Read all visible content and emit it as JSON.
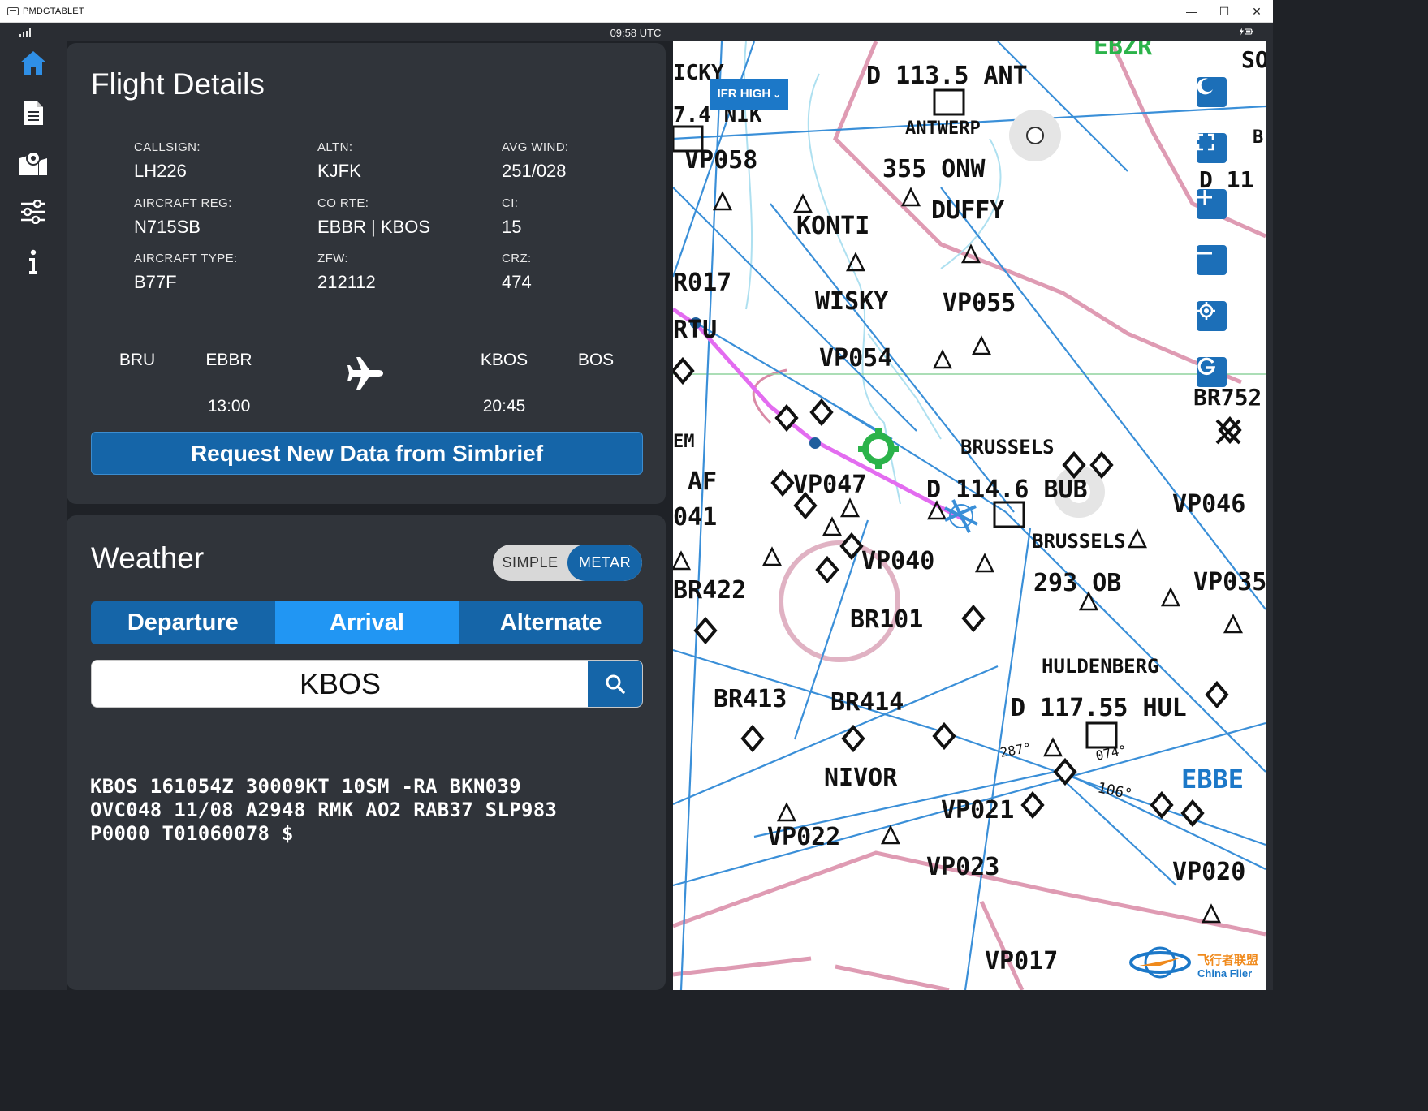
{
  "window": {
    "title": "PMDGTABLET",
    "minimize": "—",
    "maximize": "☐",
    "close": "✕"
  },
  "status": {
    "time": "09:58 UTC"
  },
  "sidebar": [
    {
      "name": "home-icon"
    },
    {
      "name": "document-icon"
    },
    {
      "name": "map-icon"
    },
    {
      "name": "settings-sliders-icon"
    },
    {
      "name": "info-icon"
    }
  ],
  "flight_details": {
    "title": "Flight Details",
    "fields": {
      "callsign": {
        "label": "CALLSIGN:",
        "value": "LH226"
      },
      "altn": {
        "label": "ALTN:",
        "value": "KJFK"
      },
      "avg_wind": {
        "label": "AVG WIND:",
        "value": "251/028"
      },
      "aircraft_reg": {
        "label": "AIRCRAFT REG:",
        "value": "N715SB"
      },
      "co_rte": {
        "label": "CO RTE:",
        "value": "EBBR | KBOS"
      },
      "ci": {
        "label": "CI:",
        "value": "15"
      },
      "aircraft_type": {
        "label": "AIRCRAFT TYPE:",
        "value": "B77F"
      },
      "zfw": {
        "label": "ZFW:",
        "value": "212112"
      },
      "crz": {
        "label": "CRZ:",
        "value": "474"
      }
    },
    "route": {
      "origin_iata": "BRU",
      "origin_icao": "EBBR",
      "dest_icao": "KBOS",
      "dest_iata": "BOS",
      "dep_time": "13:00",
      "arr_time": "20:45"
    },
    "request_button": "Request New Data from Simbrief"
  },
  "weather": {
    "title": "Weather",
    "toggle": {
      "simple": "SIMPLE",
      "metar": "METAR",
      "selected": "METAR"
    },
    "tabs": [
      "Departure",
      "Arrival",
      "Alternate"
    ],
    "active_tab": "Arrival",
    "search": {
      "value": "KBOS"
    },
    "metar": "KBOS 161054Z 30009KT 10SM -RA BKN039\nOVC048 11/08 A2948 RMK AO2 RAB37 SLP983\nP0000 T01060078 $"
  },
  "map": {
    "layer_button": "IFR HIGH",
    "labels": {
      "ant": "D 113.5 ANT",
      "antwerp": "ANTWERP",
      "onw": "355 ONW",
      "vp058": "VP058",
      "konti": "KONTI",
      "duffy": "DUFFY",
      "icky": "ICKY",
      "nik": "7.4 NIK",
      "r017": "R017",
      "wisky": "WISKY",
      "vp055": "VP055",
      "rtu": "RTU",
      "vp054": "VP054",
      "br752": "BR752",
      "brussels1": "BRUSSELS",
      "bub": "D 114.6 BUB",
      "em": "EM",
      "af": "AF",
      "vp047": "VP047",
      "n041": "041",
      "vp046": "VP046",
      "brussels2": "BRUSSELS",
      "ob": "293 OB",
      "vp040": "VP040",
      "br422": "BR422",
      "vp035": "VP035",
      "br101": "BR101",
      "huldenberg": "HULDENBERG",
      "hul": "D 117.55 HUL",
      "br413": "BR413",
      "br414": "BR414",
      "nivor": "NIVOR",
      "ebbe": "EBBE",
      "vp021": "VP021",
      "vp022": "VP022",
      "vp023": "VP023",
      "vp020": "VP020",
      "vp017": "VP017",
      "ebzr": "EBZR",
      "d11": "D 11",
      "so": "SO",
      "b_right": "B",
      "deg106": "106°",
      "deg287": "287°",
      "deg074": "074°"
    },
    "watermark_cn": "飞行者联盟",
    "watermark_en": "China Flier"
  },
  "colors": {
    "panel_bg": "#30343a",
    "app_bg": "#1f2227",
    "accent_dark": "#1565a8",
    "accent_light": "#2196f3",
    "route_magenta": "#e36cf0",
    "airway_blue": "#3a8fd8"
  }
}
